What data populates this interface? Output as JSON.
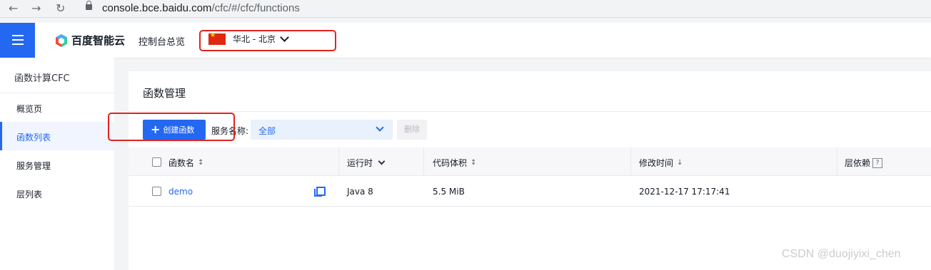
{
  "browser": {
    "back_icon": "arrow-left-icon",
    "forward_icon": "arrow-right-icon",
    "reload_icon": "reload-icon",
    "url_host": "console.bce.baidu.com",
    "url_path": "/cfc/#/cfc/functions"
  },
  "header": {
    "menu_icon": "hamburger-icon",
    "logo_text": "百度智能云",
    "overview": "控制台总览",
    "region": "华北 - 北京",
    "accent": "#2468f2"
  },
  "sidebar": {
    "title": "函数计算CFC",
    "items": [
      {
        "label": "概览页"
      },
      {
        "label": "函数列表"
      },
      {
        "label": "服务管理"
      },
      {
        "label": "层列表"
      }
    ]
  },
  "main": {
    "title": "函数管理",
    "create_label": "创建函数",
    "service_label": "服务名称:",
    "service_value": "全部",
    "delete_label": "删除",
    "columns": [
      "函数名",
      "运行时",
      "代码体积",
      "修改时间",
      "层依赖"
    ],
    "help_glyph": "?",
    "rows": [
      {
        "name": "demo",
        "runtime": "Java 8",
        "size": "5.5 MiB",
        "modified": "2021-12-17 17:17:41"
      }
    ]
  },
  "watermark": "CSDN @duojiyixi_chen",
  "highlight_color": "#e32222"
}
